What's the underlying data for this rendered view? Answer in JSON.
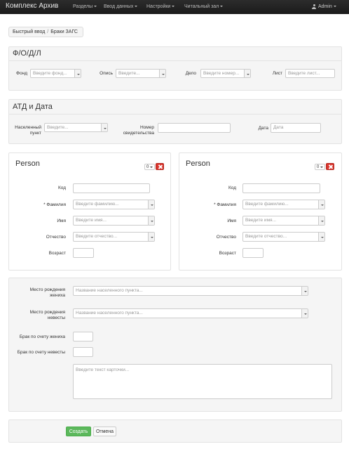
{
  "navbar": {
    "brand": "Комплекс Архив",
    "menu": [
      "Разделы",
      "Ввод данных",
      "Настройки",
      "Читальный зал"
    ],
    "user": "Admin"
  },
  "breadcrumb": [
    "Быстрый ввод",
    "Браки ЗАГС"
  ],
  "fodl": {
    "title": "Ф/О/Д/Л",
    "fond_label": "Фонд",
    "fond_placeholder": "Введите фонд...",
    "opis_label": "Опись",
    "opis_placeholder": "Введите...",
    "delo_label": "Дело",
    "delo_placeholder": "Введите номер...",
    "list_label": "Лист",
    "list_placeholder": "Введите лист..."
  },
  "atd": {
    "title": "АТД и Дата",
    "punkt_label_1": "Населенный",
    "punkt_label_2": "пункт",
    "punkt_placeholder": "Введите...",
    "nomer_label_1": "Номер",
    "nomer_label_2": "свидетельства",
    "data_label": "Дата",
    "data_placeholder": "Дата"
  },
  "persons": [
    {
      "title": "Person",
      "mini_value": "0",
      "kod_label": "Код",
      "familia_label": "* Фамилия",
      "familia_placeholder": "Введите фамилию...",
      "imya_label": "Имя",
      "imya_placeholder": "Введите имя...",
      "otchestvo_label": "Отчество",
      "otchestvo_placeholder": "Введите отчество...",
      "vozrast_label": "Возраст"
    },
    {
      "title": "Person",
      "mini_value": "0",
      "kod_label": "Код",
      "familia_label": "* Фамилия",
      "familia_placeholder": "Введите фамилию...",
      "imya_label": "Имя",
      "imya_placeholder": "Введите имя...",
      "otchestvo_label": "Отчество",
      "otchestvo_placeholder": "Введите отчество...",
      "vozrast_label": "Возраст"
    }
  ],
  "extra": {
    "mesto_zhenikh_1": "Место рождения",
    "mesto_zhenikh_2": "жениха",
    "mesto_zhenikh_placeholder": "Название населенного пункта...",
    "mesto_nevesta_1": "Место рождения",
    "mesto_nevesta_2": "невесты",
    "mesto_nevesta_placeholder": "Название населенного пункта...",
    "brak_zhenikh_label": "Брак по счету жениха",
    "brak_nevesta_label": "Брак по счету невесты",
    "text_placeholder": "Введите текст карточки..."
  },
  "actions": {
    "create": "Создать",
    "cancel": "Отмена"
  }
}
